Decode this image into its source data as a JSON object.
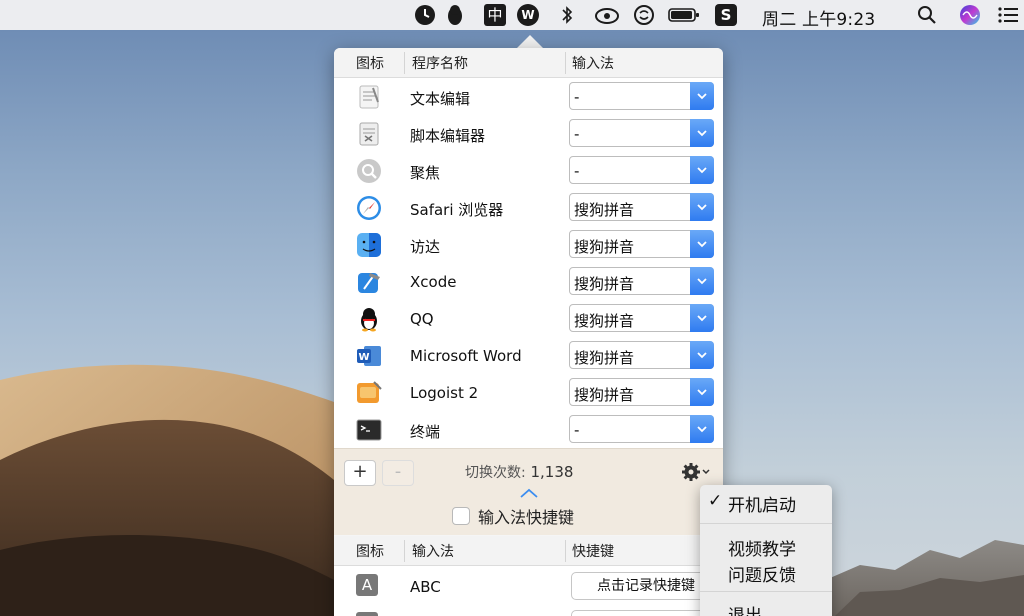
{
  "menubar": {
    "icons": [
      "clock-icon",
      "qq-penguin-icon",
      "input-method-zhong-icon",
      "wordpress-icon",
      "bluetooth-icon",
      "cloud-sync-icon",
      "sogou-icon",
      "battery-icon",
      "sogou-s-icon",
      "search-icon",
      "siri-icon",
      "list-menu-icon"
    ],
    "ime_char": "中",
    "sogou_char": "S",
    "clock": "周二 上午9:23"
  },
  "apps_table": {
    "headers": [
      "图标",
      "程序名称",
      "输入法"
    ],
    "rows": [
      {
        "icon": "textedit-icon",
        "name": "文本编辑",
        "ime": "-"
      },
      {
        "icon": "script-editor-icon",
        "name": "脚本编辑器",
        "ime": "-"
      },
      {
        "icon": "spotlight-icon",
        "name": "聚焦",
        "ime": "-"
      },
      {
        "icon": "safari-icon",
        "name": "Safari 浏览器",
        "ime": "搜狗拼音"
      },
      {
        "icon": "finder-icon",
        "name": "访达",
        "ime": "搜狗拼音"
      },
      {
        "icon": "xcode-icon",
        "name": "Xcode",
        "ime": "搜狗拼音"
      },
      {
        "icon": "qq-icon",
        "name": "QQ",
        "ime": "搜狗拼音"
      },
      {
        "icon": "word-icon",
        "name": "Microsoft Word",
        "ime": "搜狗拼音"
      },
      {
        "icon": "logoist-icon",
        "name": "Logoist 2",
        "ime": "搜狗拼音"
      },
      {
        "icon": "terminal-icon",
        "name": "终端",
        "ime": "-"
      }
    ]
  },
  "footer": {
    "add_label": "+",
    "remove_label": "-",
    "switch_count_label": "切换次数:",
    "switch_count_value": "1,138",
    "shortcut_checkbox_label": "输入法快捷键",
    "shortcut_checked": false
  },
  "ime_table": {
    "headers": [
      "图标",
      "输入法",
      "快捷键"
    ],
    "rows": [
      {
        "icon_char": "A",
        "name": "ABC",
        "shortcut_button": "点击记录快捷键"
      }
    ]
  },
  "menu": {
    "items": [
      {
        "label": "开机启动",
        "checked": true
      },
      {
        "label": "视频教学"
      },
      {
        "label": "问题反馈"
      },
      {
        "label": "退出"
      }
    ],
    "check_mark": "✓"
  },
  "colors": {
    "accent_blue": "#2f7bf0",
    "menubar_bg": "#ecedf0",
    "footer_bg": "#f1eae0"
  }
}
